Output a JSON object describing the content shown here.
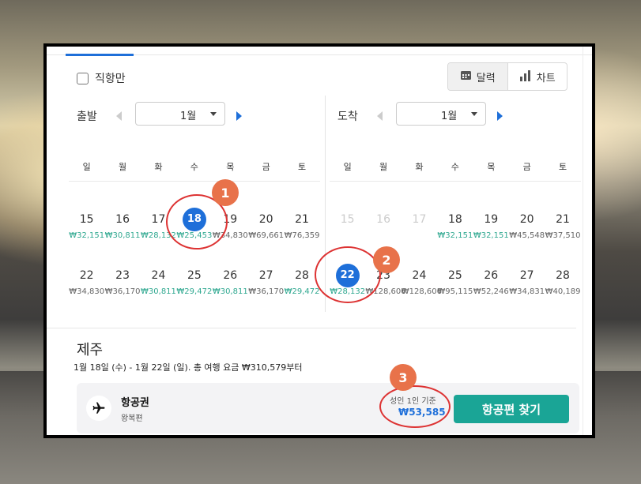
{
  "filters": {
    "direct_label": "직항만"
  },
  "view_toggle": {
    "calendar_label": "달력",
    "chart_label": "차트"
  },
  "departure": {
    "title": "출발",
    "month": "1월",
    "weekdays": [
      "일",
      "월",
      "화",
      "수",
      "목",
      "금",
      "토"
    ],
    "weeks": [
      [
        {
          "day": "15",
          "price": "₩32,151",
          "tone": "green"
        },
        {
          "day": "16",
          "price": "₩30,811",
          "tone": "green"
        },
        {
          "day": "17",
          "price": "₩28,132",
          "tone": "green"
        },
        {
          "day": "18",
          "price": "₩25,453",
          "tone": "green",
          "selected": true
        },
        {
          "day": "19",
          "price": "₩34,830",
          "tone": "gray"
        },
        {
          "day": "20",
          "price": "₩69,661",
          "tone": "gray"
        },
        {
          "day": "21",
          "price": "₩76,359",
          "tone": "gray"
        }
      ],
      [
        {
          "day": "22",
          "price": "₩34,830",
          "tone": "gray"
        },
        {
          "day": "23",
          "price": "₩36,170",
          "tone": "gray"
        },
        {
          "day": "24",
          "price": "₩30,811",
          "tone": "green"
        },
        {
          "day": "25",
          "price": "₩29,472",
          "tone": "green"
        },
        {
          "day": "26",
          "price": "₩30,811",
          "tone": "green"
        },
        {
          "day": "27",
          "price": "₩36,170",
          "tone": "gray"
        },
        {
          "day": "28",
          "price": "₩29,472",
          "tone": "green"
        }
      ]
    ]
  },
  "arrival": {
    "title": "도착",
    "month": "1월",
    "weekdays": [
      "일",
      "월",
      "화",
      "수",
      "목",
      "금",
      "토"
    ],
    "weeks": [
      [
        {
          "day": "15",
          "price": "",
          "disabled": true
        },
        {
          "day": "16",
          "price": "",
          "disabled": true
        },
        {
          "day": "17",
          "price": "",
          "disabled": true
        },
        {
          "day": "18",
          "price": "₩32,151",
          "tone": "green"
        },
        {
          "day": "19",
          "price": "₩32,151",
          "tone": "green"
        },
        {
          "day": "20",
          "price": "₩45,548",
          "tone": "gray"
        },
        {
          "day": "21",
          "price": "₩37,510",
          "tone": "gray"
        }
      ],
      [
        {
          "day": "22",
          "price": "₩28,132",
          "tone": "green",
          "selected": true
        },
        {
          "day": "23",
          "price": "₩128,606",
          "tone": "gray"
        },
        {
          "day": "24",
          "price": "₩128,606",
          "tone": "gray"
        },
        {
          "day": "25",
          "price": "₩95,115",
          "tone": "gray"
        },
        {
          "day": "26",
          "price": "₩52,246",
          "tone": "gray"
        },
        {
          "day": "27",
          "price": "₩34,831",
          "tone": "gray"
        },
        {
          "day": "28",
          "price": "₩40,189",
          "tone": "gray"
        }
      ]
    ]
  },
  "destination": "제주",
  "summary": "1월 18일 (수) - 1월 22일 (일). 총 여행 요금 ₩310,579부터",
  "flight_card": {
    "title": "항공권",
    "subtitle": "왕복편",
    "basis": "성인 1인 기준",
    "price": "₩53,585",
    "button_label": "항공편 찾기"
  },
  "markers": [
    "1",
    "2",
    "3"
  ],
  "colors": {
    "accent": "#1e6fd9",
    "green_price": "#2fa890",
    "button": "#1aa596",
    "annotation": "#e8724a"
  }
}
